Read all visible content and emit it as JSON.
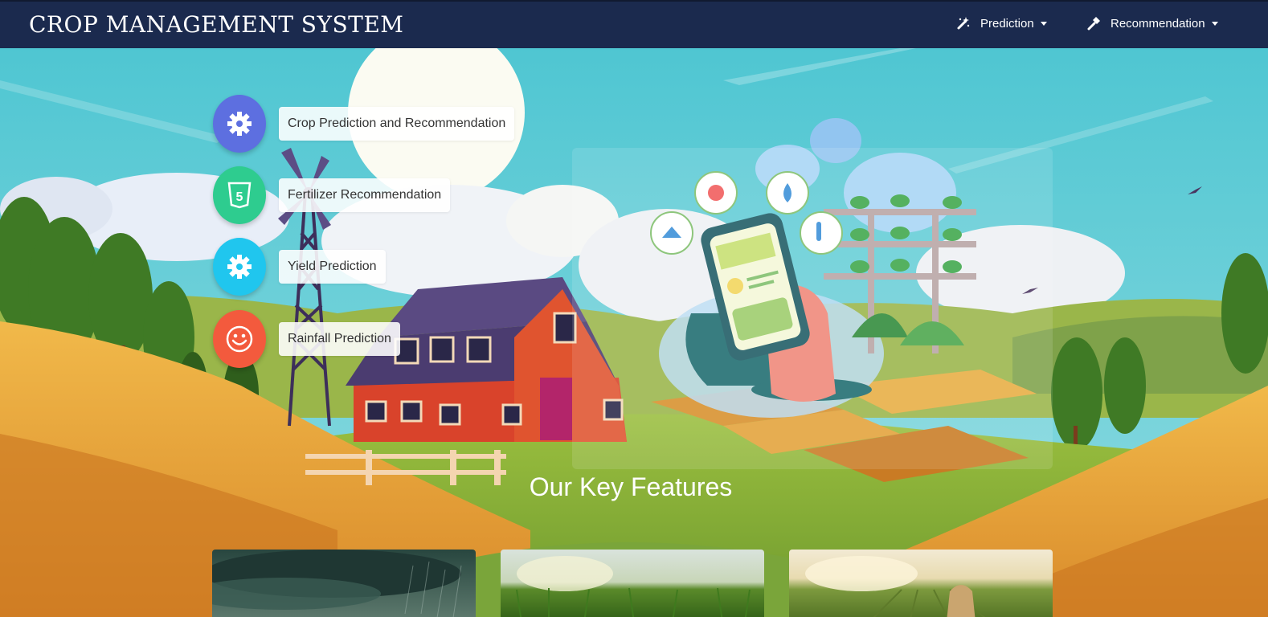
{
  "navbar": {
    "brand": "CROP MANAGEMENT SYSTEM",
    "items": [
      {
        "label": "Prediction",
        "icon": "magic-wand-icon"
      },
      {
        "label": "Recommendation",
        "icon": "hammer-icon"
      }
    ]
  },
  "features": [
    {
      "label": "Crop Prediction and Recommendation",
      "icon": "gear-icon",
      "color": "#5d6fe0"
    },
    {
      "label": "Fertilizer Recommendation",
      "icon": "html5-icon",
      "color": "#2ecc8f"
    },
    {
      "label": "Yield Prediction",
      "icon": "gear-icon",
      "color": "#20c6ee"
    },
    {
      "label": "Rainfall Prediction",
      "icon": "smile-icon",
      "color": "#f35a3d"
    }
  ],
  "section": {
    "heading": "Our Key Features"
  },
  "cards": [
    {
      "name": "storm-image"
    },
    {
      "name": "cornfield-image"
    },
    {
      "name": "fertilizer-field-image"
    }
  ],
  "colors": {
    "navbar": "#1b2a4e",
    "sky": "#5ec9cf",
    "hay": "#e4a236",
    "grass": "#7aa53a"
  }
}
